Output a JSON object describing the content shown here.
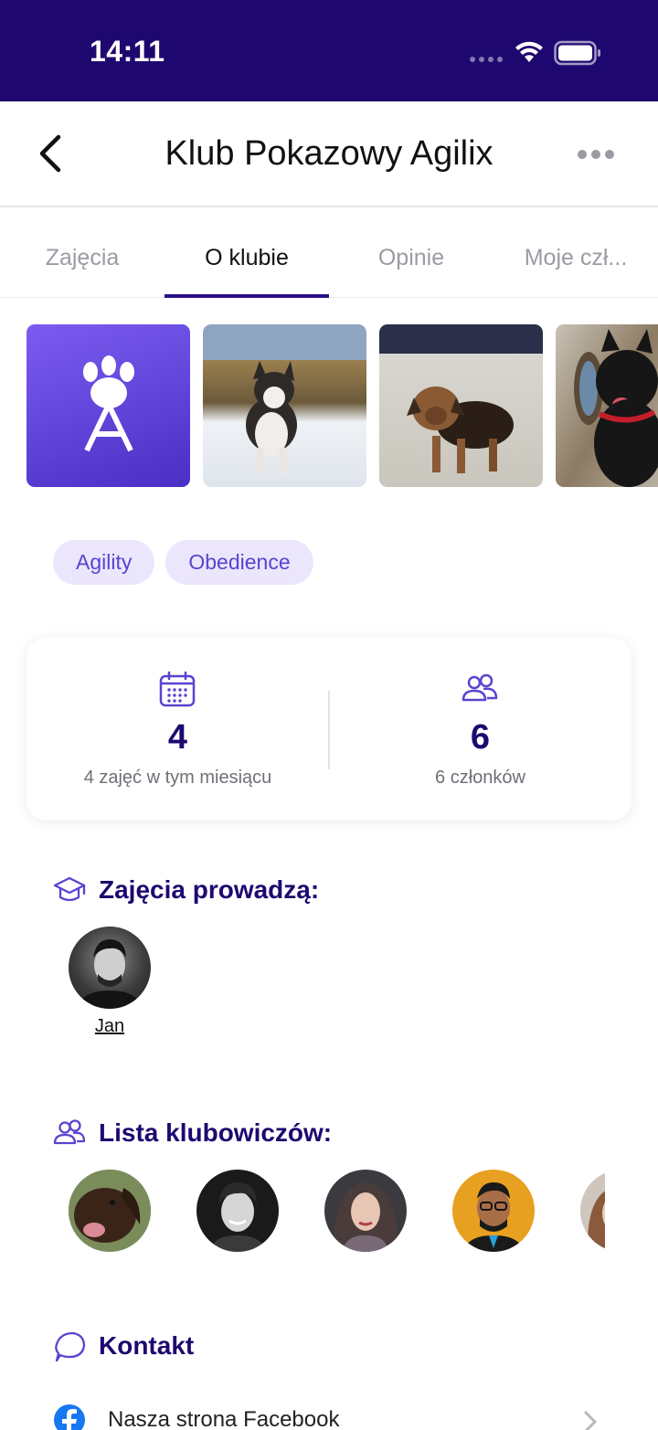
{
  "status_bar": {
    "time": "14:11"
  },
  "nav": {
    "title": "Klub Pokazowy Agilix"
  },
  "tabs": [
    {
      "label": "Zajęcia",
      "active": false
    },
    {
      "label": "O klubie",
      "active": true
    },
    {
      "label": "Opinie",
      "active": false
    },
    {
      "label": "Moje czł...",
      "active": false
    }
  ],
  "tags": [
    "Agility",
    "Obedience"
  ],
  "stats": {
    "classes": {
      "value": "4",
      "label": "4 zajęć w tym miesiącu"
    },
    "members": {
      "value": "6",
      "label": "6 członków"
    }
  },
  "instructors": {
    "title": "Zajęcia prowadzą:",
    "people": [
      {
        "name": "Jan"
      }
    ]
  },
  "club_members": {
    "title": "Lista klubowiczów:"
  },
  "contact": {
    "title": "Kontakt",
    "facebook_label": "Nasza strona Facebook"
  },
  "colors": {
    "brand": "#1e0870",
    "accent": "#5b43d0",
    "tag_bg": "#ebe6fb"
  },
  "icons": [
    "back-icon",
    "more-icon",
    "calendar-icon",
    "people-icon",
    "graduation-cap-icon",
    "chat-icon",
    "facebook-icon",
    "chevron-right-icon",
    "wifi-icon",
    "battery-icon",
    "paw-logo-icon"
  ]
}
